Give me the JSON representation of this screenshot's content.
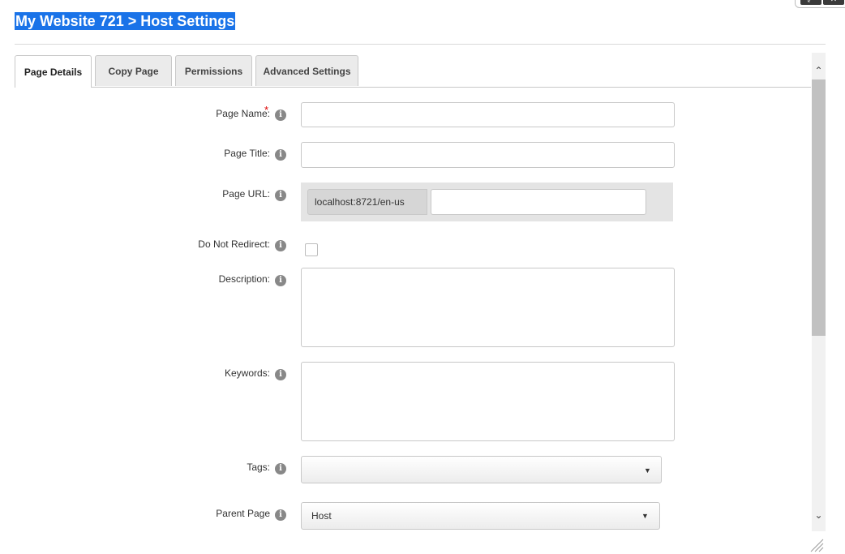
{
  "header": {
    "title": "My Website 721 > Host Settings"
  },
  "window": {
    "expand_glyph": "⤢",
    "close_glyph": "✕"
  },
  "tabs": [
    {
      "label": "Page Details",
      "active": true
    },
    {
      "label": "Copy Page",
      "active": false
    },
    {
      "label": "Permissions",
      "active": false
    },
    {
      "label": "Advanced Settings",
      "active": false
    }
  ],
  "form": {
    "page_name": {
      "label": "Page Name:",
      "required_marker": "*",
      "value": ""
    },
    "page_title": {
      "label": "Page Title:",
      "value": ""
    },
    "page_url": {
      "label": "Page URL:",
      "prefix": "localhost:8721/en-us",
      "value": ""
    },
    "do_not_redirect": {
      "label": "Do Not Redirect:",
      "checked": false
    },
    "description": {
      "label": "Description:",
      "value": ""
    },
    "keywords": {
      "label": "Keywords:",
      "value": ""
    },
    "tags": {
      "label": "Tags:",
      "selected": ""
    },
    "parent_page": {
      "label": "Parent Page",
      "selected": "Host"
    }
  },
  "icons": {
    "info": "i",
    "caret_down": "▼",
    "scroll_up": "⌃",
    "scroll_down": "⌄"
  },
  "colors": {
    "title_highlight": "#1a73e8",
    "required": "#dd0000"
  }
}
